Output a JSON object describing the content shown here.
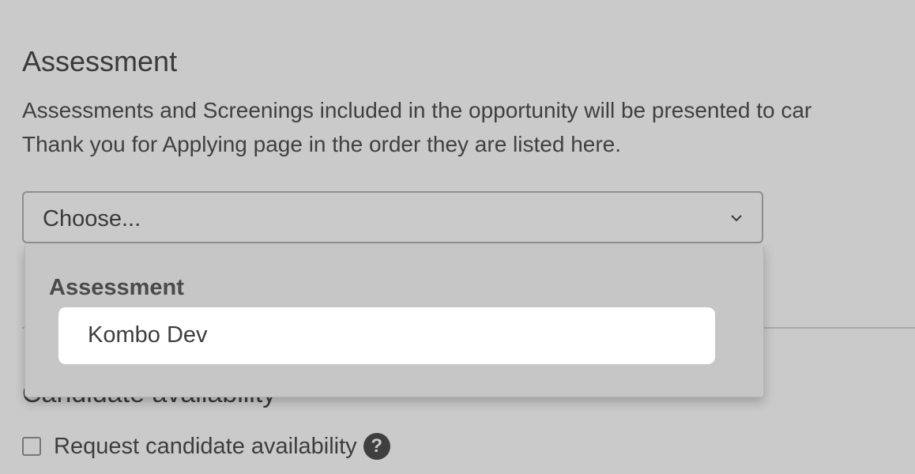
{
  "assessment": {
    "title": "Assessment",
    "description_line1": "Assessments and Screenings included in the opportunity will be presented to car",
    "description_line2": "Thank you for Applying page in the order they are listed here.",
    "select": {
      "value": "Choose...",
      "icon": "chevron-down-icon"
    },
    "dropdown": {
      "group_label": "Assessment",
      "options": [
        "Kombo Dev"
      ]
    }
  },
  "availability": {
    "title": "Candidate availability",
    "checkbox_label": "Request candidate availability",
    "checked": false,
    "help_icon": "?"
  }
}
